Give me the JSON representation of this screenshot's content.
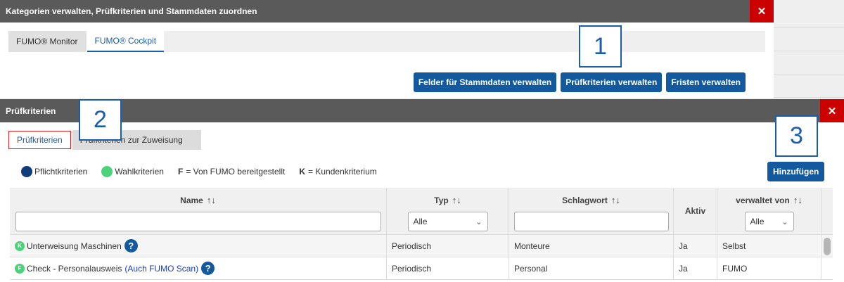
{
  "background": {
    "rows": 4
  },
  "dialog1": {
    "title": "Kategorien verwalten, Prüfkriterien und Stammdaten zuordnen",
    "close_icon": "close-icon",
    "tabs": [
      {
        "label": "FUMO® Monitor",
        "active": false
      },
      {
        "label": "FUMO® Cockpit",
        "active": true
      }
    ],
    "buttons": {
      "stammdaten": "Felder für Stammdaten verwalten",
      "pruefkriterien": "Prüfkriterien verwalten",
      "fristen": "Fristen verwalten"
    }
  },
  "dialog2": {
    "title": "Prüfkriterien",
    "tabs": [
      {
        "label": "Prüfkriterien",
        "active": true
      },
      {
        "label": "Prüfkriterien zur Zuweisung",
        "active": false
      }
    ],
    "legend": {
      "pflicht": "Pflichtkriterien",
      "wahl": "Wahlkriterien",
      "f_key": "F",
      "f_text": "= Von FUMO bereitgestellt",
      "k_key": "K",
      "k_text": "= Kundenkriterium"
    },
    "add_button": "Hinzufügen",
    "columns": {
      "name": "Name",
      "typ": "Typ",
      "typ_filter": "Alle",
      "schlagwort": "Schlagwort",
      "aktiv": "Aktiv",
      "verwaltet": "verwaltet von",
      "verwaltet_filter": "Alle",
      "sort_icon": "↑↓"
    },
    "rows": [
      {
        "badge": "K",
        "name": "Unterweisung Maschinen",
        "link": "",
        "typ": "Periodisch",
        "schlagwort": "Monteure",
        "aktiv": "Ja",
        "verwaltet": "Selbst"
      },
      {
        "badge": "F",
        "name": "Check - Personalausweis",
        "link": "(Auch FUMO Scan)",
        "typ": "Periodisch",
        "schlagwort": "Personal",
        "aktiv": "Ja",
        "verwaltet": "FUMO"
      }
    ]
  },
  "callouts": [
    "1",
    "2",
    "3"
  ],
  "colors": {
    "titlebar": "#5a5a5a",
    "close": "#cc0000",
    "primary": "#13599e",
    "pflicht": "#0f3d7a",
    "wahl": "#4cd27a"
  }
}
